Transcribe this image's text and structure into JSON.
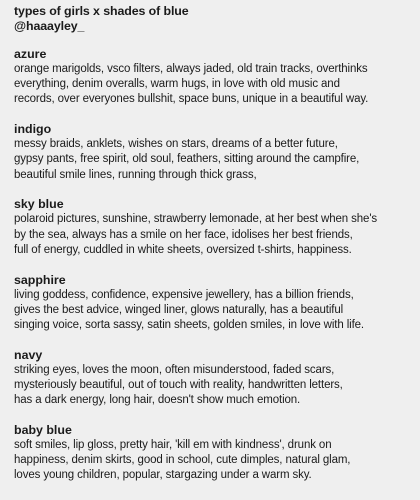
{
  "header": {
    "title": "types of girls x shades of blue",
    "handle": "@haaayley_"
  },
  "sections": [
    {
      "name": "azure",
      "lines": [
        "orange marigolds, vsco filters, always jaded, old train tracks, overthinks",
        "everything, denim overalls, warm hugs, in love with old music and",
        "records, over everyones bullshit, space buns, unique in a beautiful way."
      ]
    },
    {
      "name": "indigo",
      "lines": [
        "messy braids, anklets, wishes on stars, dreams of a better future,",
        "gypsy pants, free spirit, old soul, feathers, sitting around the campfire,",
        "beautiful smile lines, running through thick grass,"
      ]
    },
    {
      "name": "sky blue",
      "lines": [
        "polaroid pictures, sunshine, strawberry lemonade, at her best when she's",
        "by the sea, always has a smile on her face, idolises her best friends,",
        "full of energy, cuddled in white sheets, oversized t-shirts, happiness."
      ]
    },
    {
      "name": "sapphire",
      "lines": [
        "living goddess, confidence, expensive jewellery, has a billion friends,",
        "gives the best advice, winged liner, glows naturally, has a beautiful",
        "singing voice, sorta sassy, satin sheets, golden smiles, in love with life."
      ]
    },
    {
      "name": "navy",
      "lines": [
        "striking eyes, loves the moon, often misunderstood, faded scars,",
        "mysteriously beautiful, out of touch with reality, handwritten letters,",
        "has a dark energy, long hair, doesn't show much emotion."
      ]
    },
    {
      "name": "baby blue",
      "lines": [
        "soft smiles, lip gloss, pretty hair, 'kill em with kindness', drunk on",
        "happiness, denim skirts, good in school, cute dimples, natural glam,",
        "loves young children, popular, stargazing under a warm sky."
      ]
    }
  ]
}
